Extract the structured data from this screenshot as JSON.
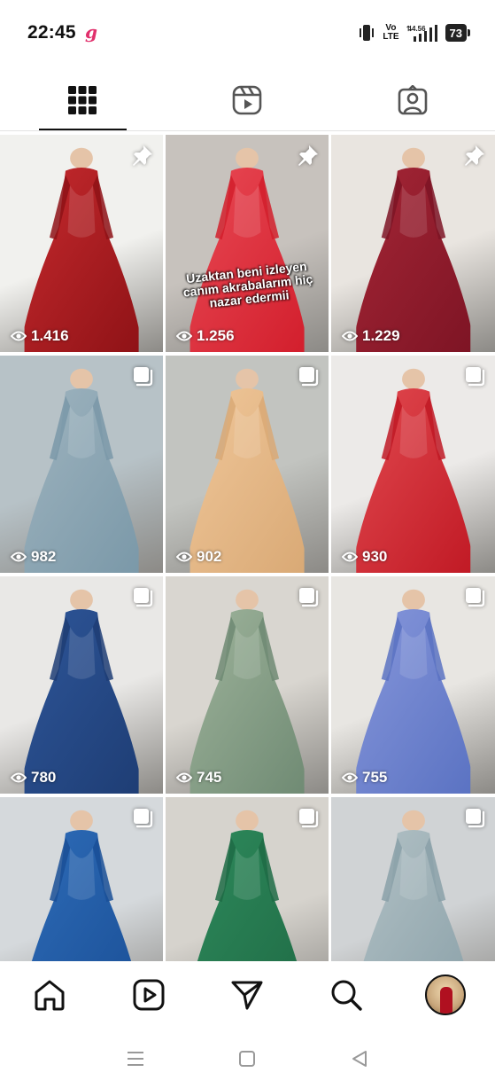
{
  "status_bar": {
    "time": "22:45",
    "app_badge": "g",
    "network_label": "Vo\nLTE",
    "speed": "4.56",
    "battery": "73"
  },
  "tabs": [
    {
      "name": "grid",
      "icon": "grid-icon",
      "active": true
    },
    {
      "name": "reels",
      "icon": "reels-icon",
      "active": false
    },
    {
      "name": "tagged",
      "icon": "tagged-icon",
      "active": false
    }
  ],
  "posts": [
    {
      "views": "1.416",
      "pinned": true,
      "caption": "",
      "colors": [
        "#f1f1ee",
        "#8e1216",
        "#c62a2e"
      ]
    },
    {
      "views": "1.256",
      "pinned": true,
      "caption": "Uzaktan beni izleyen canım akrabalarım hiç nazar edermii",
      "colors": [
        "#c7c2bd",
        "#d21e2c",
        "#e94a55"
      ]
    },
    {
      "views": "1.229",
      "pinned": true,
      "caption": "",
      "colors": [
        "#e9e5e0",
        "#7d1424",
        "#a52636"
      ]
    },
    {
      "views": "982",
      "pinned": false,
      "caption": "",
      "colors": [
        "#b7c2c7",
        "#7a98a8",
        "#9fb4bf"
      ]
    },
    {
      "views": "902",
      "pinned": false,
      "caption": "",
      "colors": [
        "#c2c4c0",
        "#d9a975",
        "#f0c79a"
      ]
    },
    {
      "views": "930",
      "pinned": false,
      "caption": "",
      "colors": [
        "#eceae8",
        "#c01924",
        "#e24a50"
      ]
    },
    {
      "views": "780",
      "pinned": false,
      "caption": "",
      "colors": [
        "#e9e8e6",
        "#1e3d74",
        "#2e5699"
      ]
    },
    {
      "views": "745",
      "pinned": false,
      "caption": "",
      "colors": [
        "#d9d6d0",
        "#6f8a73",
        "#9fb49c"
      ]
    },
    {
      "views": "755",
      "pinned": false,
      "caption": "",
      "colors": [
        "#e8e6e2",
        "#5a72c2",
        "#8797db"
      ]
    },
    {
      "views": "",
      "pinned": false,
      "caption": "",
      "colors": [
        "#d5d9dc",
        "#1a4f96",
        "#2e6cb8"
      ]
    },
    {
      "views": "",
      "pinned": false,
      "caption": "",
      "colors": [
        "#d6d3cd",
        "#1f6b45",
        "#2e8a5c"
      ]
    },
    {
      "views": "",
      "pinned": false,
      "caption": "",
      "colors": [
        "#d0d3d5",
        "#8aa0a8",
        "#b3c2c6"
      ]
    }
  ],
  "bottom_nav": [
    {
      "name": "home",
      "icon": "home-icon"
    },
    {
      "name": "reels",
      "icon": "reels-icon"
    },
    {
      "name": "direct",
      "icon": "send-icon"
    },
    {
      "name": "search",
      "icon": "search-icon"
    },
    {
      "name": "profile",
      "icon": "avatar"
    }
  ],
  "system_nav": [
    {
      "name": "recent-apps",
      "icon": "menu-lines-icon"
    },
    {
      "name": "home",
      "icon": "square-icon"
    },
    {
      "name": "back",
      "icon": "back-triangle-icon"
    }
  ]
}
